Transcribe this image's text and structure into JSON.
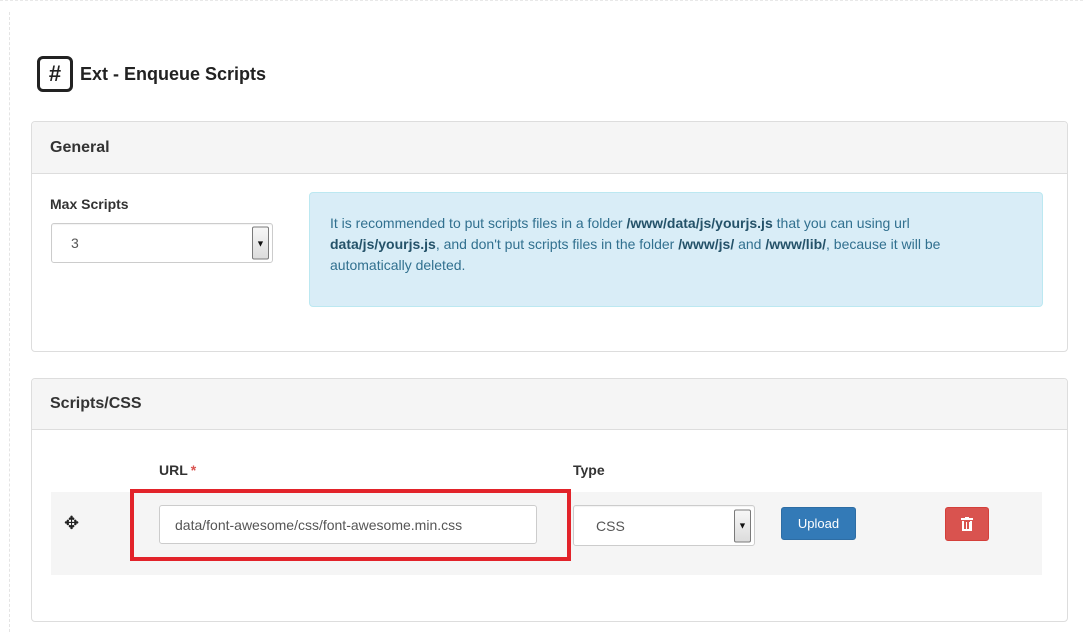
{
  "page": {
    "icon": "hashtag-icon",
    "title": "Ext - Enqueue Scripts"
  },
  "general": {
    "heading": "General",
    "max_scripts_label": "Max Scripts",
    "max_scripts_value": "3",
    "info": {
      "t1": "It is recommended to put scripts files in a folder ",
      "b1": "/www/data/js/yourjs.js",
      "t2": " that you can using url ",
      "b2": "data/js/yourjs.js",
      "t3": ", and don't put scripts files in the folder ",
      "b3": "/www/js/",
      "t4": " and ",
      "b4": "/www/lib/",
      "t5": ", because it will be automatically deleted."
    }
  },
  "scripts": {
    "heading": "Scripts/CSS",
    "url_label": "URL",
    "required_mark": "*",
    "type_label": "Type",
    "rows": [
      {
        "drag_icon": "move-icon",
        "url": "data/font-awesome/css/font-awesome.min.css",
        "type": "CSS",
        "upload_label": "Upload",
        "delete_icon": "trash-icon"
      }
    ]
  },
  "colors": {
    "highlight": "#e2232a",
    "upload_button": "#337ab7",
    "delete_button": "#d9534f",
    "info_bg": "#d9edf7"
  }
}
